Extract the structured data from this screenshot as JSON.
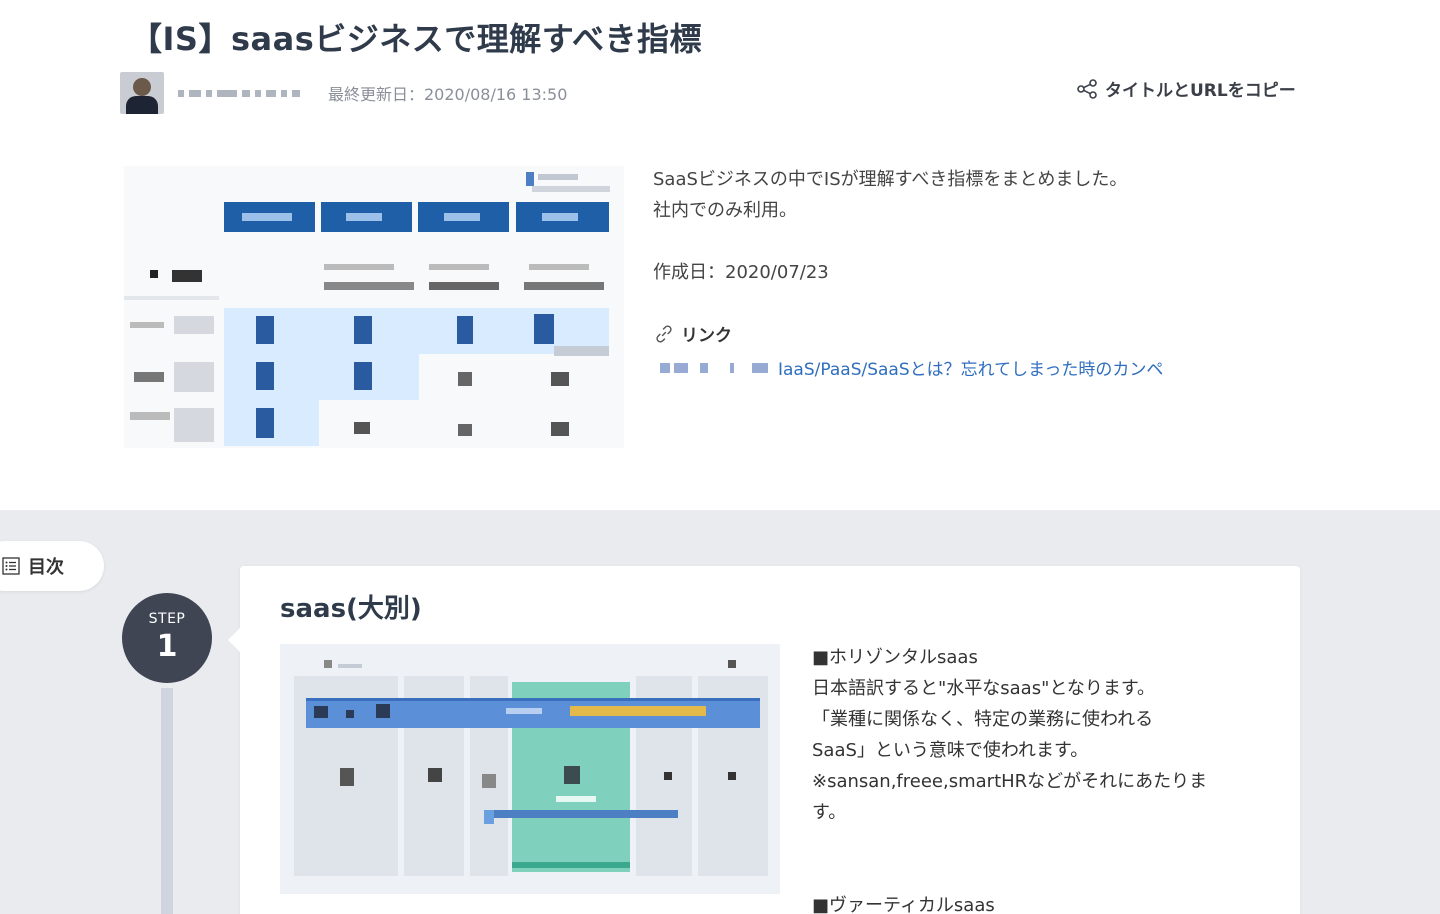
{
  "article": {
    "title": "【IS】saasビジネスで理解すべき指標",
    "updated": "最終更新日：2020/08/16 13:50",
    "copy_label": "タイトルとURLをコピー",
    "description_lines": [
      "SaaSビジネスの中でISが理解すべき指標をまとめました。",
      "社内でのみ利用。"
    ],
    "created": "作成日：2020/07/23",
    "link_heading": "リンク",
    "link_text": "IaaS/PaaS/SaaSとは？忘れてしまった時のカンペ"
  },
  "toc": {
    "label": "目次"
  },
  "step": {
    "label": "STEP",
    "number": "1",
    "title": "saas(大別)",
    "text_lines": [
      "■ホリゾンタルsaas",
      "日本語訳すると\"水平なsaas\"となります。",
      "「業種に関係なく、特定の業務に使われる",
      "SaaS」という意味で使われます。",
      "※sansan,freee,smartHRなどがそれにあたりま",
      "す。"
    ],
    "text_next": "■ヴァーティカルsaas"
  },
  "icons": {
    "copy": "share-icon",
    "link": "link-icon",
    "toc": "list-icon"
  },
  "colors": {
    "title": "#2f3b4a",
    "link": "#2f6ebf",
    "step_badge": "#3f4553",
    "content_bg": "#e9ebef",
    "table_header": "#1f5fa8",
    "table_highlight": "#d9ecff",
    "diagram_bar": "#5b8fd8",
    "diagram_column": "#7fd1bd"
  }
}
